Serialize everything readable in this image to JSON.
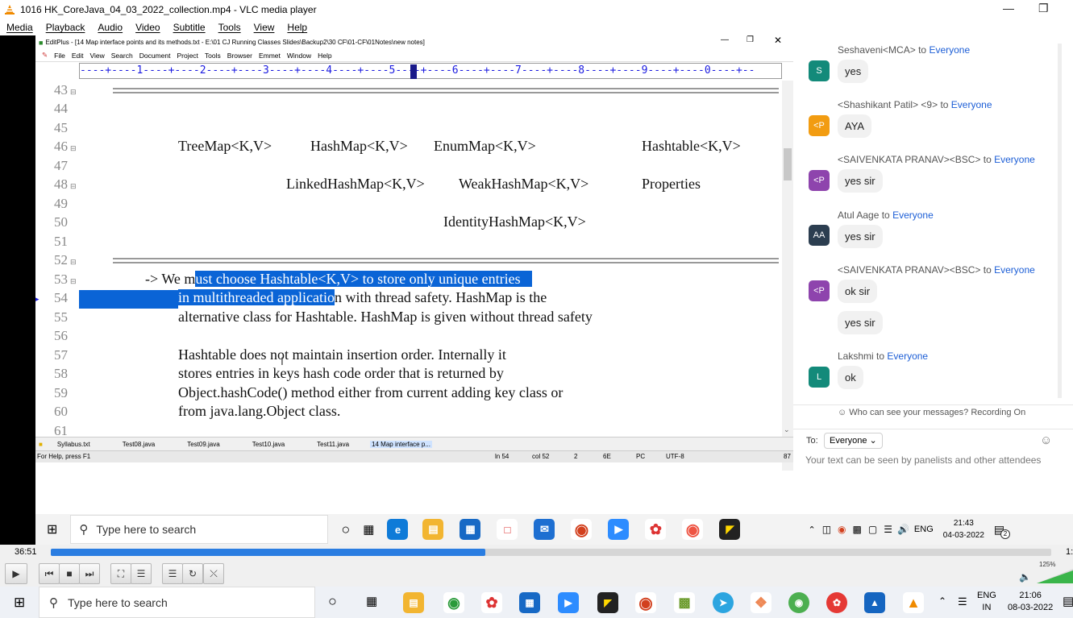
{
  "vlc": {
    "title": "1016 HK_CoreJava_04_03_2022_collection.mp4 - VLC media player",
    "menu": [
      "Media",
      "Playback",
      "Audio",
      "Video",
      "Subtitle",
      "Tools",
      "View",
      "Help"
    ],
    "elapsed": "36:51",
    "remaining": "1:",
    "progress_fraction": 0.434,
    "volume": "125%"
  },
  "editplus": {
    "title": "EditPlus - [14 Map interface points and its methods.txt - E:\\01 CJ Running Classes Slides\\Backup2\\30 CF\\01-CF\\01Notes\\new notes]",
    "menu": [
      "File",
      "Edit",
      "View",
      "Search",
      "Document",
      "Project",
      "Tools",
      "Browser",
      "Emmet",
      "Window",
      "Help"
    ],
    "ruler": "----+----1----+----2----+----3----+----4----+----5----+----6----+----7----+----8----+----9----+----0----+--",
    "line_numbers": [
      "43",
      "44",
      "45",
      "46",
      "47",
      "48",
      "49",
      "50",
      "51",
      "52",
      "53",
      "54",
      "55",
      "56",
      "57",
      "58",
      "59",
      "60",
      "61"
    ],
    "code": {
      "l46a": "TreeMap<K,V>",
      "l46b": "HashMap<K,V>",
      "l46c": "EnumMap<K,V>",
      "l46d": "Hashtable<K,V>",
      "l48a": "LinkedHashMap<K,V>",
      "l48b": "WeakHashMap<K,V>",
      "l48c": "Properties",
      "l50": "IdentityHashMap<K,V>",
      "l53a": "-> We m",
      "l53b": "ust choose Hashtable<K,V> to store only unique entries",
      "l54a": "in multithreaded applicatio",
      "l54b": "n with thread safety. HashMap is the",
      "l55": "alternative class for Hashtable. HashMap is given without thread safety",
      "l57": "Hashtable does not maintain insertion order. Internally it",
      "l58": "stores entries in keys hash code order that is returned by",
      "l59": "Object.hashCode() method either from current adding key class or",
      "l60": "from java.lang.Object class."
    },
    "tabs": [
      "Syllabus.txt",
      "Test08.java",
      "Test09.java",
      "Test10.java",
      "Test11.java",
      "14 Map interface p..."
    ],
    "status": {
      "help": "For Help, press F1",
      "ln": "ln 54",
      "col": "col 52",
      "n1": "2",
      "n2": "6E",
      "mode": "PC",
      "enc": "UTF-8",
      "n3": "87"
    }
  },
  "chat": {
    "messages": [
      {
        "sender": "Seshaveni<MCA>",
        "to": "Everyone",
        "initials": "S",
        "color": "#138a7a",
        "text": "yes"
      },
      {
        "sender": "<Shashikant Patil>  <9>",
        "to": "Everyone",
        "initials": "<P",
        "color": "#f29c11",
        "text": "AYA"
      },
      {
        "sender": "<SAIVENKATA PRANAV><BSC>",
        "to": "Everyone",
        "initials": "<P",
        "color": "#8e44ad",
        "text": "yes sir"
      },
      {
        "sender": "Atul Aage",
        "to": "Everyone",
        "initials": "AA",
        "color": "#2c3e50",
        "text": "yes sir"
      },
      {
        "sender": "<SAIVENKATA PRANAV><BSC>",
        "to": "Everyone",
        "initials": "<P",
        "color": "#8e44ad",
        "text": "ok sir"
      },
      {
        "sender": "",
        "to": "",
        "initials": "",
        "color": "",
        "text": "yes sir"
      },
      {
        "sender": "Lakshmi",
        "to": "Everyone",
        "initials": "L",
        "color": "#138a7a",
        "text": "ok"
      }
    ],
    "to_word": "to",
    "visibility": "Who can see your messages? Recording On",
    "to_label": "To:",
    "recipient": "Everyone",
    "placeholder": "Your text can be seen by panelists and other attendees"
  },
  "inner_taskbar": {
    "search": "Type here to search",
    "lang": "ENG",
    "time": "21:43",
    "date": "04-03-2022",
    "notif": "2"
  },
  "taskbar": {
    "search": "Type here to search",
    "lang1": "ENG",
    "lang2": "IN",
    "time": "21:06",
    "date": "08-03-2022"
  }
}
